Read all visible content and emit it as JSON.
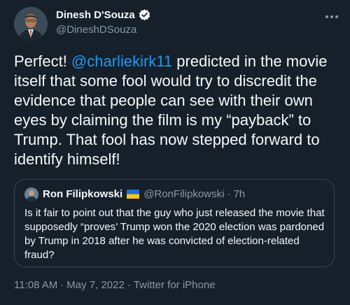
{
  "author": {
    "name": "Dinesh D'Souza",
    "handle": "@DineshDSouza",
    "icons": {
      "verified": "verified-badge-icon",
      "more": "more-options-icon"
    }
  },
  "tweet": {
    "text_prefix": "Perfect! ",
    "mention": "@charliekirk11",
    "text_suffix": " predicted in the movie itself that some fool would try to discredit the evidence that people can see with their own eyes by claiming the film is my “payback” to Trump. That fool has now stepped forward to identify himself!"
  },
  "quoted": {
    "name": "Ron Filipkowski",
    "flag": "ukraine-flag-icon",
    "handle": "@RonFilipkowski",
    "separator": "·",
    "time": "7h",
    "text": "Is it fair to point out that the guy who just released the movie that supposedly “proves’ Trump won the 2020 election was pardoned by Trump in 2018 after he was convicted of election-related fraud?"
  },
  "meta": {
    "time": "11:08 AM",
    "separator": "·",
    "date": "May 7, 2022",
    "source": "Twitter for iPhone"
  },
  "colors": {
    "background": "#15202b",
    "text": "#f7f9f9",
    "secondary": "#8b98a5",
    "accent": "#1d9bf0",
    "border": "#38444d"
  }
}
